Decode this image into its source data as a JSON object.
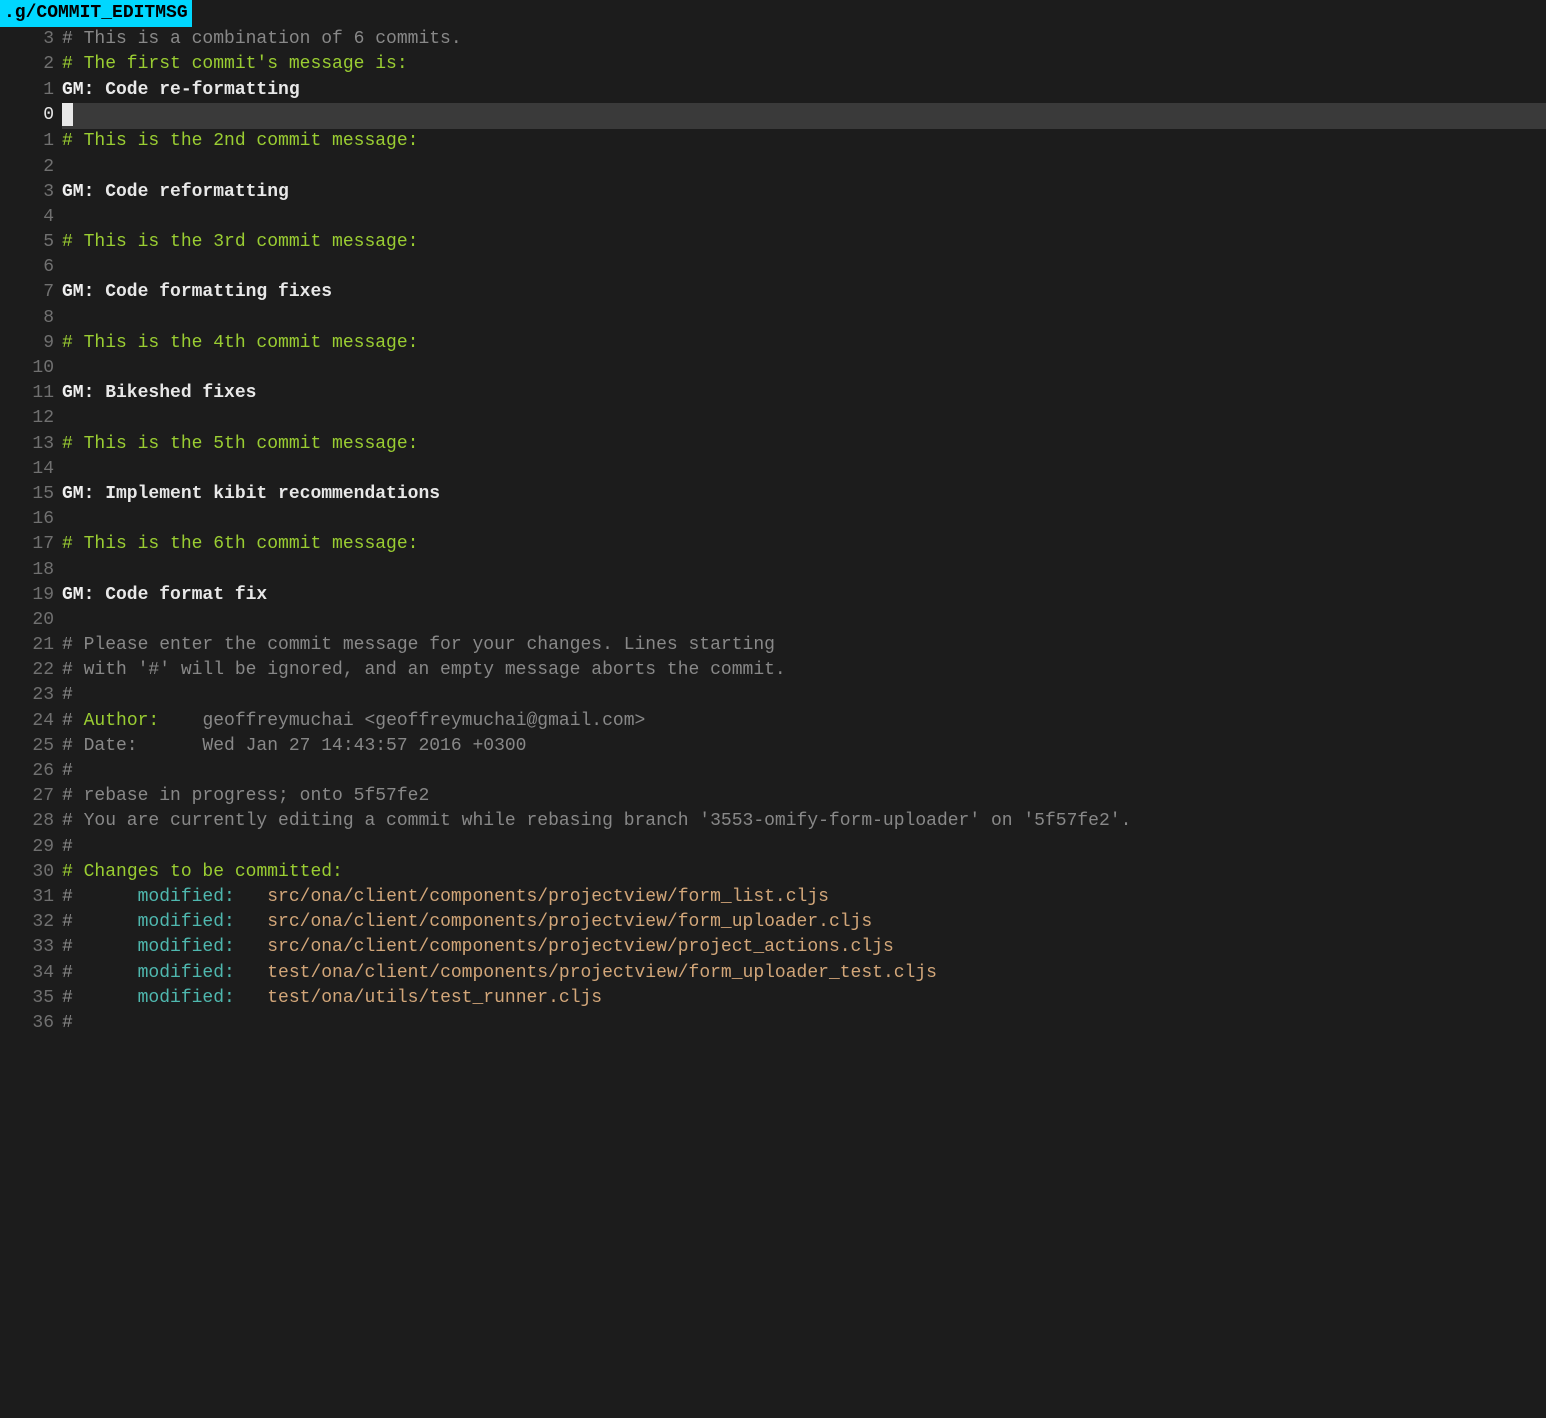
{
  "filename": ".g/COMMIT_EDITMSG",
  "lines": [
    {
      "num": "3",
      "type": "comment-gray",
      "text": "# This is a combination of 6 commits."
    },
    {
      "num": "2",
      "type": "comment-green",
      "text": "# The first commit's message is:"
    },
    {
      "num": "1",
      "type": "gm",
      "prefix": "GM:",
      "text": " Code re-formatting"
    },
    {
      "num": "0",
      "type": "cursor",
      "text": ""
    },
    {
      "num": "1",
      "type": "comment-green",
      "text": "# This is the 2nd commit message:"
    },
    {
      "num": "2",
      "type": "empty",
      "text": ""
    },
    {
      "num": "3",
      "type": "gm",
      "prefix": "GM:",
      "text": " Code reformatting"
    },
    {
      "num": "4",
      "type": "empty",
      "text": ""
    },
    {
      "num": "5",
      "type": "comment-green",
      "text": "# This is the 3rd commit message:"
    },
    {
      "num": "6",
      "type": "empty",
      "text": ""
    },
    {
      "num": "7",
      "type": "gm",
      "prefix": "GM:",
      "text": " Code formatting fixes"
    },
    {
      "num": "8",
      "type": "empty",
      "text": ""
    },
    {
      "num": "9",
      "type": "comment-green",
      "text": "# This is the 4th commit message:"
    },
    {
      "num": "10",
      "type": "empty",
      "text": ""
    },
    {
      "num": "11",
      "type": "gm",
      "prefix": "GM:",
      "text": " Bikeshed fixes"
    },
    {
      "num": "12",
      "type": "empty",
      "text": ""
    },
    {
      "num": "13",
      "type": "comment-green",
      "text": "# This is the 5th commit message:"
    },
    {
      "num": "14",
      "type": "empty",
      "text": ""
    },
    {
      "num": "15",
      "type": "gm",
      "prefix": "GM:",
      "text": " Implement kibit recommendations"
    },
    {
      "num": "16",
      "type": "empty",
      "text": ""
    },
    {
      "num": "17",
      "type": "comment-green",
      "text": "# This is the 6th commit message:"
    },
    {
      "num": "18",
      "type": "empty",
      "text": ""
    },
    {
      "num": "19",
      "type": "gm",
      "prefix": "GM:",
      "text": " Code format fix"
    },
    {
      "num": "20",
      "type": "empty",
      "text": ""
    },
    {
      "num": "21",
      "type": "comment-gray",
      "text": "# Please enter the commit message for your changes. Lines starting"
    },
    {
      "num": "22",
      "type": "comment-gray",
      "text": "# with '#' will be ignored, and an empty message aborts the commit."
    },
    {
      "num": "23",
      "type": "comment-gray",
      "text": "#"
    },
    {
      "num": "24",
      "type": "author",
      "hash": "# ",
      "label": "Author:",
      "text": "    geoffreymuchai <geoffreymuchai@gmail.com>"
    },
    {
      "num": "25",
      "type": "comment-gray",
      "text": "# Date:      Wed Jan 27 14:43:57 2016 +0300"
    },
    {
      "num": "26",
      "type": "comment-gray",
      "text": "#"
    },
    {
      "num": "27",
      "type": "comment-gray",
      "text": "# rebase in progress; onto 5f57fe2"
    },
    {
      "num": "28",
      "type": "comment-gray",
      "text": "# You are currently editing a commit while rebasing branch '3553-omify-form-uploader' on '5f57fe2'."
    },
    {
      "num": "29",
      "type": "comment-gray",
      "text": "#"
    },
    {
      "num": "30",
      "type": "changes-header",
      "hash": "# ",
      "text": "Changes to be committed:"
    },
    {
      "num": "31",
      "type": "modified",
      "hash": "#",
      "label": "      modified:",
      "text": "   src/ona/client/components/projectview/form_list.cljs"
    },
    {
      "num": "32",
      "type": "modified",
      "hash": "#",
      "label": "      modified:",
      "text": "   src/ona/client/components/projectview/form_uploader.cljs"
    },
    {
      "num": "33",
      "type": "modified",
      "hash": "#",
      "label": "      modified:",
      "text": "   src/ona/client/components/projectview/project_actions.cljs"
    },
    {
      "num": "34",
      "type": "modified",
      "hash": "#",
      "label": "      modified:",
      "text": "   test/ona/client/components/projectview/form_uploader_test.cljs"
    },
    {
      "num": "35",
      "type": "modified",
      "hash": "#",
      "label": "      modified:",
      "text": "   test/ona/utils/test_runner.cljs"
    },
    {
      "num": "36",
      "type": "comment-gray",
      "text": "#"
    }
  ]
}
